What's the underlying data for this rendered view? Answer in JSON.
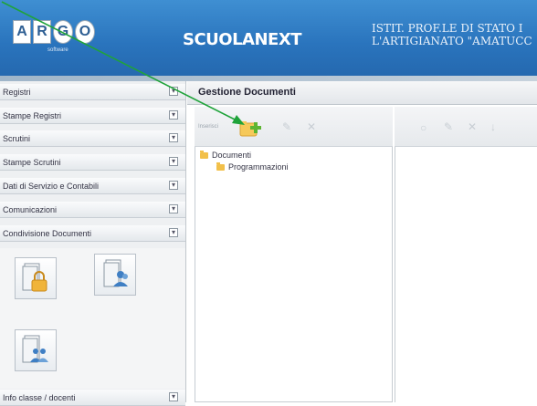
{
  "header": {
    "logo_letters": [
      "A",
      "R",
      "G",
      "O"
    ],
    "logo_subtitle": "software",
    "brand": "SCUOLANEXT",
    "school_line1": "ISTIT. PROF.LE DI STATO I",
    "school_line2": "L'ARTIGIANATO \"AMATUCC"
  },
  "sidebar": {
    "items": [
      {
        "label": "Registri"
      },
      {
        "label": "Stampe Registri"
      },
      {
        "label": "Scrutini"
      },
      {
        "label": "Stampe Scrutini"
      },
      {
        "label": "Dati di Servizio e Contabili"
      },
      {
        "label": "Comunicazioni"
      },
      {
        "label": "Condivisione Documenti"
      },
      {
        "label": "Info classe / docenti"
      }
    ],
    "toggle_symbol": "▾"
  },
  "main": {
    "title": "Gestione Documenti",
    "toolbar_label": "Inserisci",
    "tree": {
      "root": "Documenti",
      "child": "Programmazioni"
    }
  },
  "colors": {
    "header": "#2a74bd",
    "arrow": "#1fa33a",
    "add_icon": "#5cb531"
  }
}
